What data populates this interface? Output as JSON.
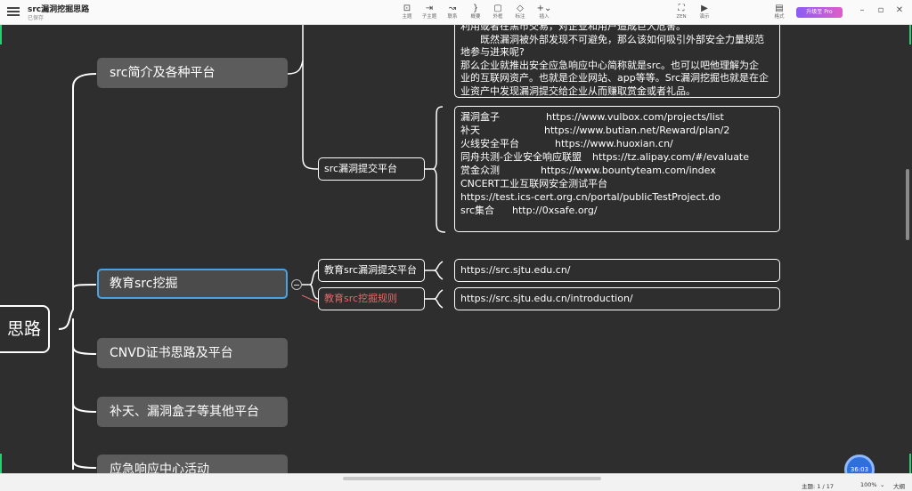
{
  "app": {
    "doc_title": "src漏洞挖掘思路",
    "doc_status": "已保存",
    "pro_label": "升级至 Pro"
  },
  "toolbar": {
    "items": [
      {
        "label": "主题",
        "icon": "topic-icon"
      },
      {
        "label": "子主题",
        "icon": "subtopic-icon"
      },
      {
        "label": "联系",
        "icon": "relationship-icon"
      },
      {
        "label": "概要",
        "icon": "summary-icon"
      },
      {
        "label": "外框",
        "icon": "boundary-icon"
      },
      {
        "label": "标注",
        "icon": "callout-icon"
      },
      {
        "label": "插入",
        "icon": "insert-icon"
      }
    ],
    "right_items": [
      {
        "label": "ZEN",
        "icon": "zen-icon"
      },
      {
        "label": "演示",
        "icon": "present-icon"
      },
      {
        "label": "格式",
        "icon": "format-icon"
      }
    ]
  },
  "map": {
    "root": "思路",
    "topics": [
      {
        "label": "src简介及各种平台"
      },
      {
        "label": "教育src挖掘"
      },
      {
        "label": "CNVD证书思路及平台"
      },
      {
        "label": "补天、漏洞盒子等其他平台"
      },
      {
        "label": "应急响应中心活动"
      }
    ],
    "note_top": [
      "利用或者在黑市交易，对企业和用户造成巨大危害。",
      "　　既然漏洞被外部发现不可避免，那么该如何吸引外部安全力量规范",
      "地参与进来呢?",
      "那么企业就推出安全应急响应中心简称就是src。也可以吧他理解为企",
      "业的互联网资产。也就是企业网站、app等等。Src漏洞挖掘也就是在企",
      "业资产中发现漏洞提交给企业从而赚取赏金或者礼品。"
    ],
    "submit_platform": {
      "label": "src漏洞提交平台",
      "platforms": [
        {
          "name": "漏洞盒子",
          "url": "https://www.vulbox.com/projects/list"
        },
        {
          "name": "补天",
          "url": "https://www.butian.net/Reward/plan/2"
        },
        {
          "name": "火线安全平台",
          "url": "https://www.huoxian.cn/"
        },
        {
          "name": "同舟共测-企业安全响应联盟",
          "url": "https://tz.alipay.com/#/evaluate"
        },
        {
          "name": "赏金众测",
          "url": "https://www.bountyteam.com/index"
        },
        {
          "name": "CNCERT工业互联网安全测试平台",
          "url": ""
        },
        {
          "name": "https://test.ics-cert.org.cn/portal/publicTestProject.do",
          "url": ""
        },
        {
          "name": "src集合",
          "url": "http://0xsafe.org/"
        }
      ]
    },
    "edu": {
      "submit_label": "教育src漏洞提交平台",
      "submit_url": "https://src.sjtu.edu.cn/",
      "rules_label": "教育src挖掘规则",
      "rules_url": "https://src.sjtu.edu.cn/introduction/"
    }
  },
  "status": {
    "topic_count": "主题: 1 / 17",
    "zoom": "100%",
    "size_label": "大纲",
    "time_badge": "36:03"
  },
  "colors": {
    "canvas": "#2e2e2e",
    "topic_fill": "#5c5c5c",
    "selected_border": "#4aa3df",
    "accent_green": "#2ecc71"
  }
}
